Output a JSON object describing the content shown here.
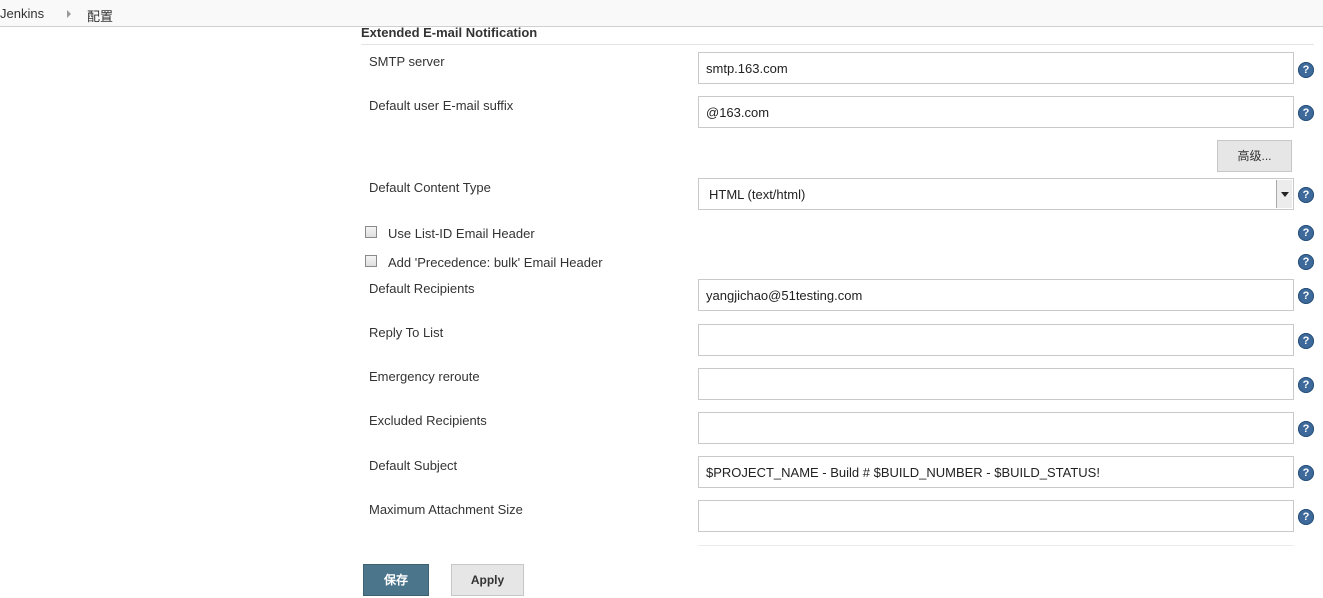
{
  "breadcrumb": {
    "home": "Jenkins",
    "current": "配置"
  },
  "section": {
    "title": "Extended E-mail Notification"
  },
  "fields": {
    "smtp_server": {
      "label": "SMTP server",
      "value": "smtp.163.com"
    },
    "default_suffix": {
      "label": "Default user E-mail suffix",
      "value": "@163.com"
    },
    "advanced_button": "高级...",
    "content_type": {
      "label": "Default Content Type",
      "value": "HTML (text/html)"
    },
    "list_id": {
      "label": "Use List-ID Email Header",
      "checked": false
    },
    "precedence": {
      "label": "Add 'Precedence: bulk' Email Header",
      "checked": false
    },
    "default_recipients": {
      "label": "Default Recipients",
      "value": "yangjichao@51testing.com"
    },
    "reply_to": {
      "label": "Reply To List",
      "value": ""
    },
    "emergency_reroute": {
      "label": "Emergency reroute",
      "value": ""
    },
    "excluded_recipients": {
      "label": "Excluded Recipients",
      "value": ""
    },
    "default_subject": {
      "label": "Default Subject",
      "value": "$PROJECT_NAME - Build # $BUILD_NUMBER - $BUILD_STATUS!"
    },
    "max_attachment": {
      "label": "Maximum Attachment Size",
      "value": ""
    }
  },
  "help_icon": "?",
  "buttons": {
    "save": "保存",
    "apply": "Apply"
  },
  "colors": {
    "save_button": "#4b758b",
    "help_icon": "#3d6a9a"
  }
}
